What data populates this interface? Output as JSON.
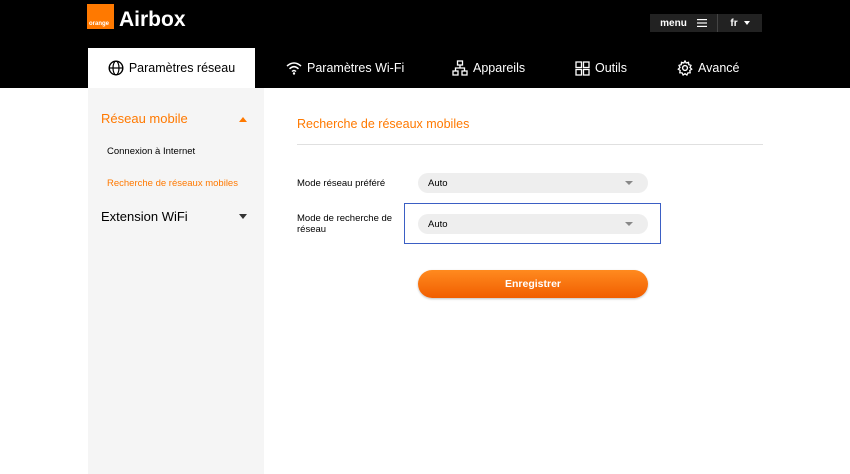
{
  "header": {
    "logo_text": "orange",
    "brand": "Airbox",
    "menu_label": "menu",
    "lang_label": "fr"
  },
  "nav": {
    "tabs": [
      {
        "label": "Paramètres réseau",
        "icon": "globe-icon",
        "active": true
      },
      {
        "label": "Paramètres Wi-Fi",
        "icon": "wifi-icon"
      },
      {
        "label": "Appareils",
        "icon": "network-icon"
      },
      {
        "label": "Outils",
        "icon": "apps-icon"
      },
      {
        "label": "Avancé",
        "icon": "gear-icon"
      }
    ]
  },
  "sidebar": {
    "sections": [
      {
        "label": "Réseau mobile",
        "expanded": true,
        "items": [
          "Connexion à Internet",
          "Recherche de réseaux mobiles"
        ]
      },
      {
        "label": "Extension WiFi",
        "expanded": false
      }
    ],
    "active_item": "Recherche de réseaux mobiles"
  },
  "main": {
    "title": "Recherche de réseaux mobiles",
    "fields": [
      {
        "label": "Mode réseau préféré",
        "value": "Auto"
      },
      {
        "label": "Mode de recherche de réseau",
        "value": "Auto"
      }
    ],
    "save_label": "Enregistrer"
  },
  "colors": {
    "accent": "#ff7900",
    "highlight": "#3b5fc4"
  }
}
